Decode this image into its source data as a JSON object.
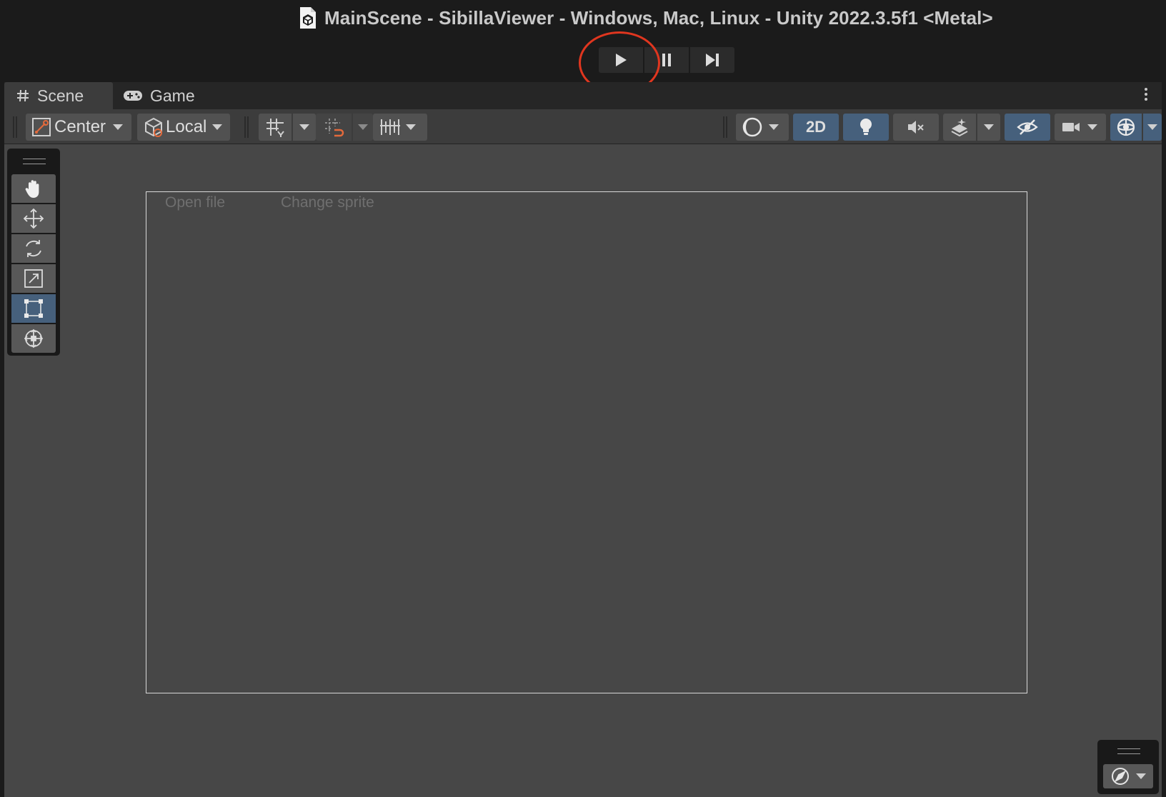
{
  "window": {
    "title": "MainScene - SibillaViewer - Windows, Mac, Linux - Unity 2022.3.5f1 <Metal>",
    "app_icon": "unity-scene-icon"
  },
  "playmode": {
    "buttons": [
      {
        "icon": "play-icon",
        "highlighted": true
      },
      {
        "icon": "pause-icon"
      },
      {
        "icon": "step-icon"
      }
    ],
    "highlight_color": "#e0361f"
  },
  "tabs": [
    {
      "label": "Scene",
      "icon": "hash-icon",
      "active": true
    },
    {
      "label": "Game",
      "icon": "gamepad-icon",
      "active": false
    }
  ],
  "toolbar": {
    "pivot_mode": "Center",
    "pivot_rotation": "Local",
    "toggle_2d_label": "2D",
    "icons": [
      "grid-snap-icon",
      "increment-snap-icon",
      "grid-visibility-icon",
      "draw-mode-icon",
      "lighting-icon",
      "audio-mute-icon",
      "effects-icon",
      "scene-visibility-icon",
      "camera-icon",
      "gizmos-icon"
    ],
    "accent_color": "#46607c"
  },
  "tools": [
    {
      "name": "hand-tool",
      "icon": "hand-icon",
      "selected": false
    },
    {
      "name": "move-tool",
      "icon": "move-icon",
      "selected": false
    },
    {
      "name": "rotate-tool",
      "icon": "rotate-icon",
      "selected": false
    },
    {
      "name": "scale-tool",
      "icon": "scale-icon",
      "selected": false
    },
    {
      "name": "rect-tool",
      "icon": "rect-icon",
      "selected": true
    },
    {
      "name": "transform-tool",
      "icon": "transform-icon",
      "selected": false
    }
  ],
  "canvas": {
    "open_file_label": "Open file",
    "change_sprite_label": "Change sprite"
  },
  "orientation": {
    "icon": "compass-icon"
  }
}
